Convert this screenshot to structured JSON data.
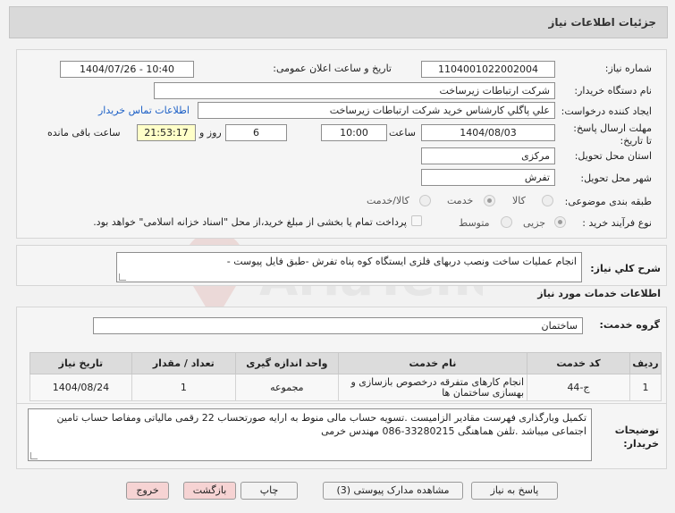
{
  "page_title": "جزئيات اطلاعات نياز",
  "fields": {
    "need_number_label": "شماره نياز:",
    "need_number": "1104001022002004",
    "announce_label": "تاريخ و ساعت اعلان عمومی:",
    "announce_value": "1404/07/26 - 10:40",
    "buyer_org_label": "نام دستگاه خريدار:",
    "buyer_org": "شركت ارتباطات زيرساخت",
    "creator_label": "ايجاد كننده درخواست:",
    "creator": "علي پاگلي كارشناس خريد شركت ارتباطات زيرساخت",
    "contact_link": "اطلاعات تماس خريدار",
    "deadline_label": "مهلت ارسال پاسخ: تا تاریخ:",
    "deadline_date": "1404/08/03",
    "time_label": "ساعت",
    "deadline_time": "10:00",
    "days_value": "6",
    "days_label": "روز و",
    "remaining_time": "21:53:17",
    "remaining_label": "ساعت باقی مانده",
    "province_label": "استان محل تحويل:",
    "province": "مرکزی",
    "city_label": "شهر محل تحويل:",
    "city": "تفرش",
    "category_label": "طبقه بندی موضوعی:",
    "category_options": [
      "کالا",
      "خدمت",
      "کالا/خدمت"
    ],
    "process_label": "نوع فرآیند خرید :",
    "process_options": [
      "جزیی",
      "متوسط"
    ],
    "payment_text": "پرداخت تمام یا بخشی از مبلغ خرید،از محل \"اسناد خزانه اسلامی\" خواهد بود."
  },
  "summary": {
    "label": "شرح كلي نياز:",
    "value": "انجام عملیات ساخت ونصب دربهای فلزی ایستگاه کوه پناه تفرش -طبق فایل پیوست -"
  },
  "services": {
    "section_title": "اطلاعات خدمات مورد نياز",
    "group_label": "گروه خدمت:",
    "group_value": "ساختمان",
    "columns": [
      "رديف",
      "كد خدمت",
      "نام خدمت",
      "واحد اندازه گيری",
      "تعداد / مقدار",
      "تاريخ نياز"
    ],
    "rows": [
      [
        "1",
        "ج-44",
        "انجام کارهای متفرقه درخصوص بازسازی و بهسازی ساختمان ها",
        "مجموعه",
        "1",
        "1404/08/24"
      ]
    ]
  },
  "notes": {
    "label": "توضيحات خريدار:",
    "value": "تکمیل وبارگذاری فهرست مقادیر الزامیست .تسویه حساب مالی منوط به ارایه صورتحساب 22 رقمی مالیاتی ومفاصا حساب تامین اجتماعی میباشد .تلفن هماهنگی   33280215-086 مهندس خرمی"
  },
  "buttons": {
    "reply": "پاسخ به نياز",
    "attachments": "مشاهده مدارک پيوستی (3)",
    "print": "چاپ",
    "back": "بازگشت",
    "exit": "خروج"
  },
  "watermark": "AriaTender.net"
}
